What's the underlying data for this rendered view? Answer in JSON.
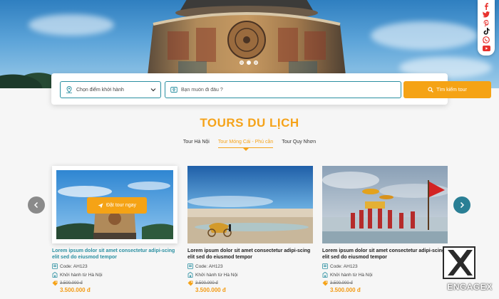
{
  "hero": {
    "carousel_dots": 3,
    "active_dot": 1
  },
  "social": {
    "icons": [
      "facebook-icon",
      "twitter-icon",
      "pinterest-icon",
      "tiktok-icon",
      "whatsapp-icon",
      "youtube-icon"
    ]
  },
  "search": {
    "departure_placeholder": "Chọn điểm khởi hành",
    "destination_placeholder": "Bạn muốn đi đâu ?",
    "button_label": "Tìm kiếm tour"
  },
  "section": {
    "title": "TOURS DU LỊCH",
    "tabs": [
      {
        "label": "Tour Hà Nội",
        "active": false
      },
      {
        "label": "Tour Móng Cái - Phú cần",
        "active": true
      },
      {
        "label": "Tour Quy Nhơn",
        "active": false
      }
    ]
  },
  "cards": [
    {
      "name": "Lorem ipsum dolor sit amet consectetur adipi-scing elit sed do eiusmod tempor",
      "code": "Code: AH123",
      "departure": "Khởi hành từ Hà Nội",
      "old_price": "3.500.000 đ",
      "price": "3.500.000 đ",
      "book_label": "Đặt tour ngay"
    },
    {
      "name": "Lorem ipsum dolor sit amet consectetur adipi-scing elit sed do eiusmod tempor",
      "code": "Code: AH123",
      "departure": "Khởi hành từ Hà Nội",
      "old_price": "3.500.000 đ",
      "price": "3.500.000 đ"
    },
    {
      "name": "Lorem ipsum dolor sit amet consectetur adipi-scing elit sed do eiusmod tempor",
      "code": "Code: AH123",
      "departure": "Khởi hành từ Hà Nội",
      "old_price": "3.500.000 đ",
      "price": "3.500.000 đ"
    }
  ],
  "watermark": {
    "label": "ENGAGEX"
  },
  "colors": {
    "accent": "#f5a31a",
    "teal": "#2a8fa1",
    "price": "#f39a12"
  }
}
